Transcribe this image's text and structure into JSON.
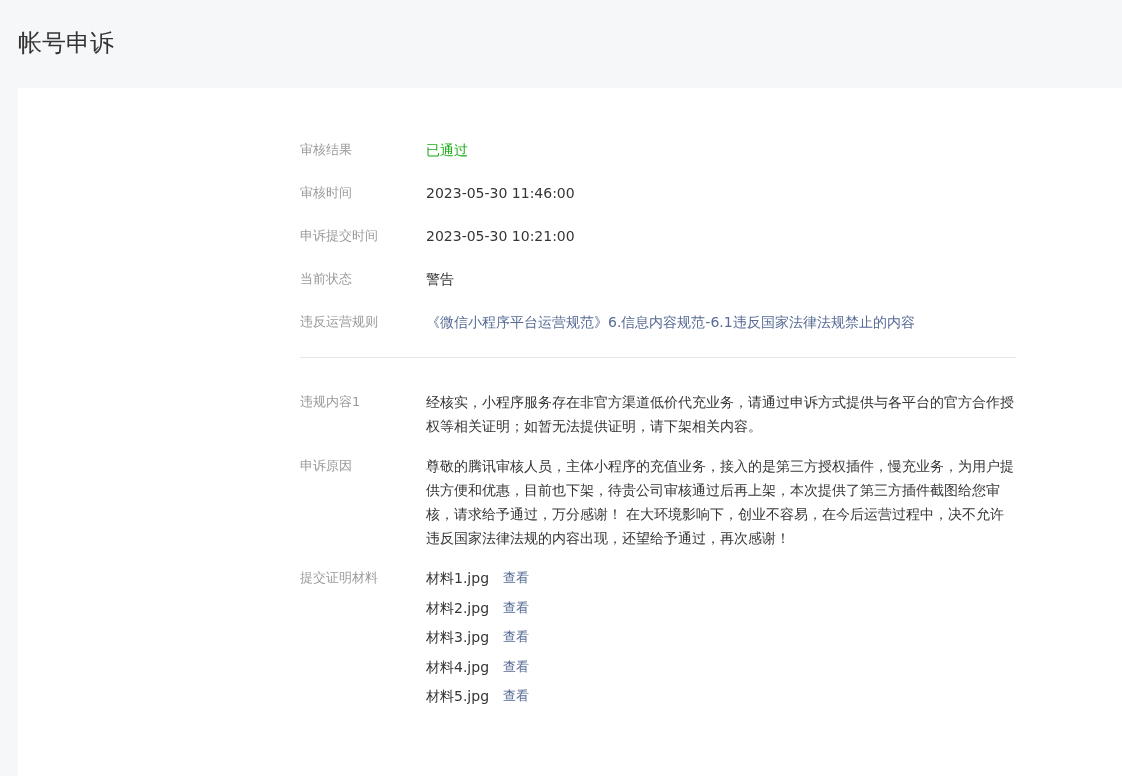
{
  "page_title": "帐号申诉",
  "summary": [
    {
      "label": "审核结果",
      "value": "已通过",
      "kind": "status"
    },
    {
      "label": "审核时间",
      "value": "2023-05-30 11:46:00",
      "kind": "text"
    },
    {
      "label": "申诉提交时间",
      "value": "2023-05-30 10:21:00",
      "kind": "text"
    },
    {
      "label": "当前状态",
      "value": "警告",
      "kind": "text"
    },
    {
      "label": "违反运营规则",
      "value": "《微信小程序平台运营规范》6.信息内容规范-6.1违反国家法律法规禁止的内容",
      "kind": "link"
    }
  ],
  "details": [
    {
      "label": "违规内容1",
      "text": "经核实，小程序服务存在非官方渠道低价代充业务，请通过申诉方式提供与各平台的官方合作授权等相关证明；如暂无法提供证明，请下架相关内容。"
    },
    {
      "label": "申诉原因",
      "text": "尊敬的腾讯审核人员，主体小程序的充值业务，接入的是第三方授权插件，慢充业务，为用户提供方便和优惠，目前也下架，待贵公司审核通过后再上架，本次提供了第三方插件截图给您审核，请求给予通过，万分感谢！ 在大环境影响下，创业不容易，在今后运营过程中，决不允许违反国家法律法规的内容出现，还望给予通过，再次感谢！"
    }
  ],
  "materials": {
    "label": "提交证明材料",
    "files": [
      {
        "name": "材料1.jpg",
        "action": "查看"
      },
      {
        "name": "材料2.jpg",
        "action": "查看"
      },
      {
        "name": "材料3.jpg",
        "action": "查看"
      },
      {
        "name": "材料4.jpg",
        "action": "查看"
      },
      {
        "name": "材料5.jpg",
        "action": "查看"
      }
    ]
  }
}
